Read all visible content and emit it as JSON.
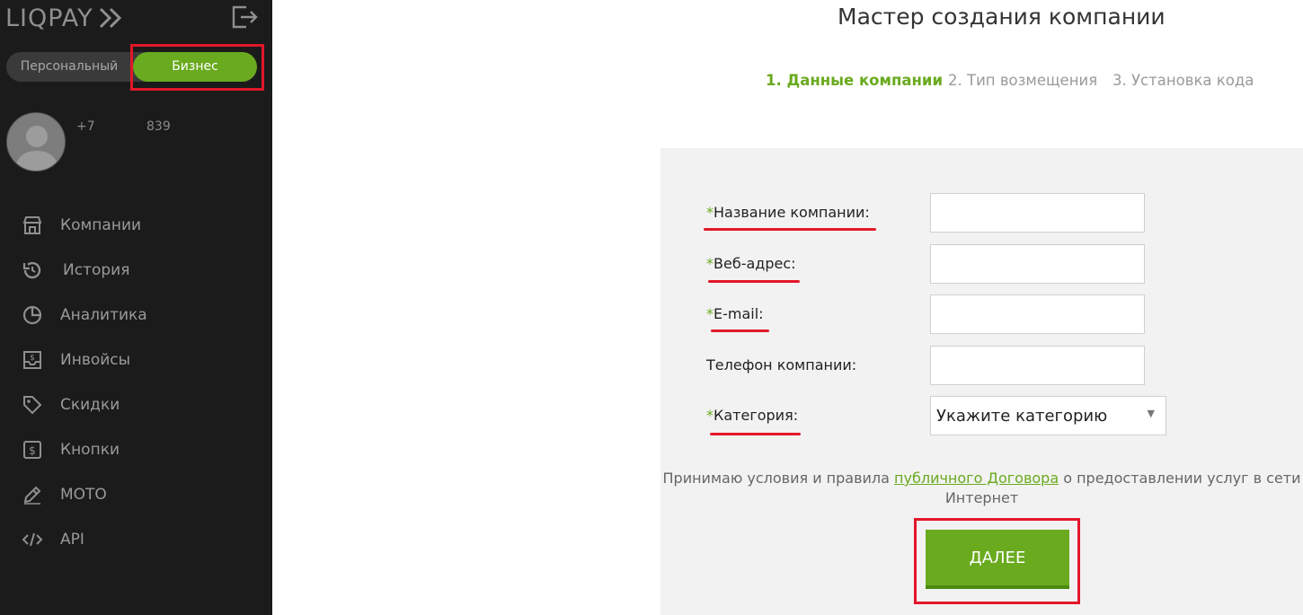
{
  "sidebar": {
    "logo_text": "LIQPAY",
    "mode_toggle": {
      "personal": "Персональный",
      "business": "Бизнес",
      "active": "business"
    },
    "user": {
      "phone_start": "+7",
      "phone_end": "839"
    },
    "nav": [
      {
        "label": "Компании",
        "icon": "store-icon"
      },
      {
        "label": "История",
        "icon": "history-icon"
      },
      {
        "label": "Аналитика",
        "icon": "pie-chart-icon"
      },
      {
        "label": "Инвойсы",
        "icon": "invoice-icon"
      },
      {
        "label": "Скидки",
        "icon": "tag-icon"
      },
      {
        "label": "Кнопки",
        "icon": "dollar-button-icon"
      },
      {
        "label": "МОТО",
        "icon": "pen-icon"
      },
      {
        "label": "API",
        "icon": "code-icon"
      }
    ]
  },
  "wizard": {
    "title": "Мастер создания компании",
    "steps": [
      {
        "label": "1. Данные компании",
        "active": true
      },
      {
        "label": "2. Тип возмещения",
        "active": false
      },
      {
        "label": "3. Установка кода",
        "active": false
      }
    ]
  },
  "form": {
    "required_mark": "*",
    "fields": [
      {
        "label": "Название компании:",
        "required": true,
        "value": ""
      },
      {
        "label": "Веб-адрес:",
        "required": true,
        "value": ""
      },
      {
        "label": "E-mail:",
        "required": true,
        "value": ""
      },
      {
        "label": "Телефон компании:",
        "required": false,
        "value": ""
      },
      {
        "label": "Категория:",
        "required": true,
        "value": "Укажите категорию"
      }
    ],
    "terms": {
      "before": "Принимаю условия и правила ",
      "link": "публичного Договора",
      "after": " о предоставлении услуг в сети",
      "line2": "Интернет"
    },
    "next_button": "ДАЛЕЕ"
  },
  "colors": {
    "accent": "#6aaa1f",
    "highlight": "#e3172a",
    "sidebar_bg": "#1b1b1b",
    "panel_bg": "#f2f2f2"
  }
}
